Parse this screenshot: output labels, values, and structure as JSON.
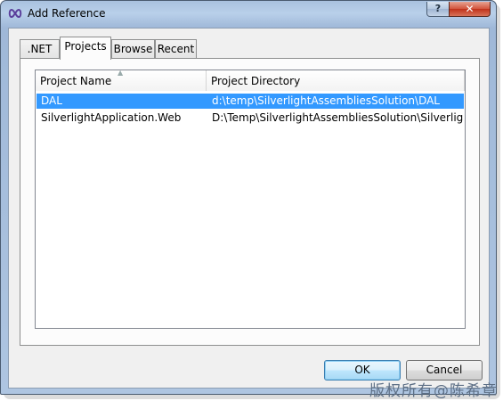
{
  "window": {
    "title": "Add Reference",
    "help_label": "?",
    "close_label": "✕"
  },
  "tabs": [
    {
      "label": ".NET",
      "active": false
    },
    {
      "label": "Projects",
      "active": true
    },
    {
      "label": "Browse",
      "active": false
    },
    {
      "label": "Recent",
      "active": false
    }
  ],
  "list": {
    "columns": [
      "Project Name",
      "Project Directory"
    ],
    "sort_indicator": "ascending",
    "rows": [
      {
        "name": "DAL",
        "directory": "d:\\temp\\SilverlightAssembliesSolution\\DAL",
        "selected": true
      },
      {
        "name": "SilverlightApplication.Web",
        "directory": "D:\\Temp\\SilverlightAssembliesSolution\\Silverlight...",
        "selected": false
      }
    ]
  },
  "buttons": {
    "ok_label": "OK",
    "cancel_label": "Cancel"
  },
  "watermark": "版权所有@陈希章",
  "colors": {
    "selection": "#3399ff",
    "titlebar": "#b9d0ea",
    "close_button": "#c0321b"
  }
}
